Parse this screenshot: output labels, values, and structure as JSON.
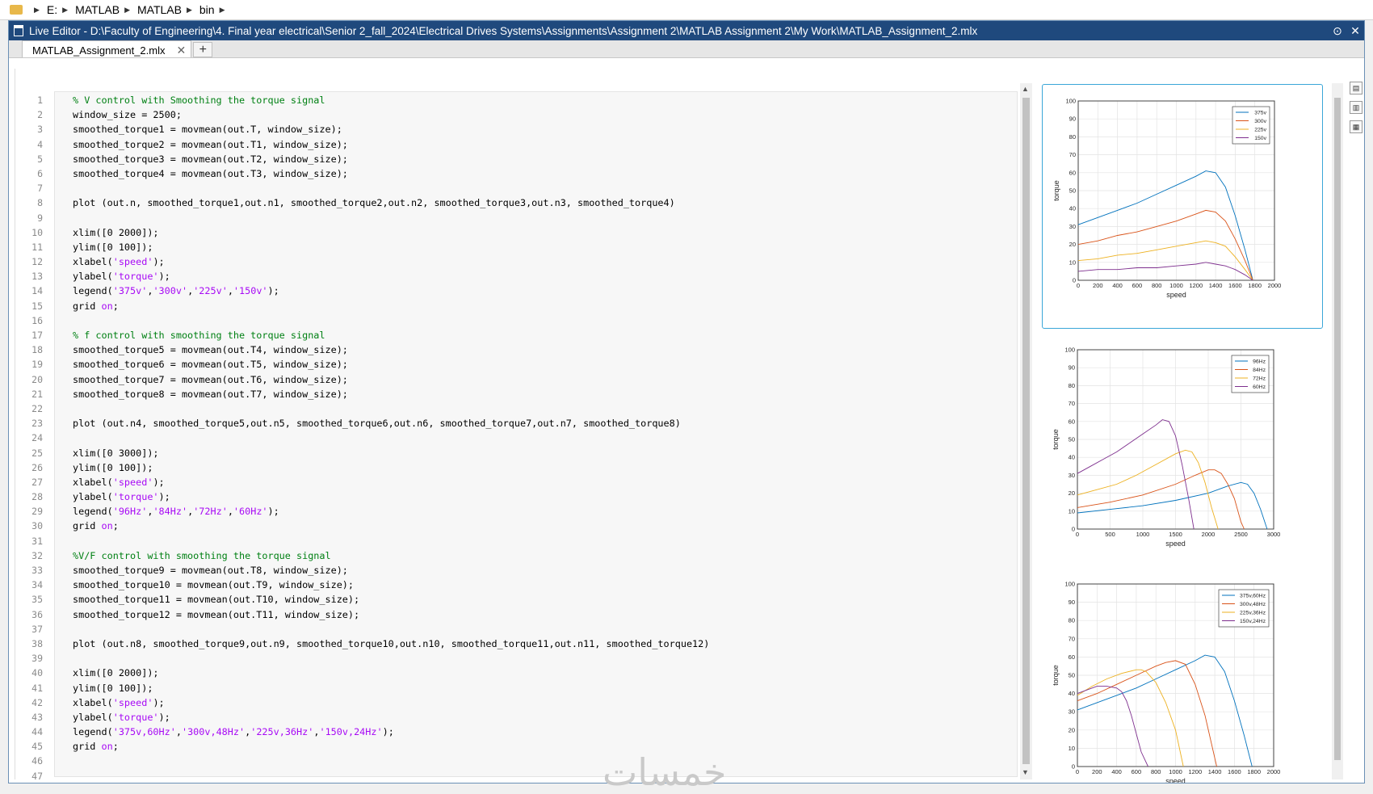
{
  "breadcrumb": [
    "E:",
    "MATLAB",
    "MATLAB",
    "bin"
  ],
  "window": {
    "title": "Live Editor - D:\\Faculty of Engineering\\4. Final year electrical\\Senior 2_fall_2024\\Electrical Drives Systems\\Assignments\\Assignment 2\\MATLAB Assignment 2\\My Work\\MATLAB_Assignment_2.mlx"
  },
  "tab": {
    "label": "MATLAB_Assignment_2.mlx",
    "add": "+"
  },
  "watermark": "خمسات",
  "code": [
    [
      [
        "cm",
        "% V control with Smoothing the torque signal"
      ]
    ],
    [
      [
        "",
        "window_size = 2500;"
      ]
    ],
    [
      [
        "",
        "smoothed_torque1 = movmean(out.T, window_size);"
      ]
    ],
    [
      [
        "",
        "smoothed_torque2 = movmean(out.T1, window_size);"
      ]
    ],
    [
      [
        "",
        "smoothed_torque3 = movmean(out.T2, window_size);"
      ]
    ],
    [
      [
        "",
        "smoothed_torque4 = movmean(out.T3, window_size);"
      ]
    ],
    [],
    [
      [
        "",
        "plot (out.n, smoothed_torque1,out.n1, smoothed_torque2,out.n2, smoothed_torque3,out.n3, smoothed_torque4)"
      ]
    ],
    [],
    [
      [
        "",
        "xlim([0 2000]);"
      ]
    ],
    [
      [
        "",
        "ylim([0 100]);"
      ]
    ],
    [
      [
        "",
        "xlabel("
      ],
      [
        "st",
        "'speed'"
      ],
      [
        "",
        ");"
      ]
    ],
    [
      [
        "",
        "ylabel("
      ],
      [
        "st",
        "'torque'"
      ],
      [
        "",
        ");"
      ]
    ],
    [
      [
        "",
        "legend("
      ],
      [
        "st",
        "'375v'"
      ],
      [
        "",
        ","
      ],
      [
        "st",
        "'300v'"
      ],
      [
        "",
        ","
      ],
      [
        "st",
        "'225v'"
      ],
      [
        "",
        ","
      ],
      [
        "st",
        "'150v'"
      ],
      [
        "",
        ");"
      ]
    ],
    [
      [
        "",
        "grid "
      ],
      [
        "kw",
        "on"
      ],
      [
        "",
        ";"
      ]
    ],
    [],
    [
      [
        "cm",
        "% f control with smoothing the torque signal"
      ]
    ],
    [
      [
        "",
        "smoothed_torque5 = movmean(out.T4, window_size);"
      ]
    ],
    [
      [
        "",
        "smoothed_torque6 = movmean(out.T5, window_size);"
      ]
    ],
    [
      [
        "",
        "smoothed_torque7 = movmean(out.T6, window_size);"
      ]
    ],
    [
      [
        "",
        "smoothed_torque8 = movmean(out.T7, window_size);"
      ]
    ],
    [],
    [
      [
        "",
        "plot (out.n4, smoothed_torque5,out.n5, smoothed_torque6,out.n6, smoothed_torque7,out.n7, smoothed_torque8)"
      ]
    ],
    [],
    [
      [
        "",
        "xlim([0 3000]);"
      ]
    ],
    [
      [
        "",
        "ylim([0 100]);"
      ]
    ],
    [
      [
        "",
        "xlabel("
      ],
      [
        "st",
        "'speed'"
      ],
      [
        "",
        ");"
      ]
    ],
    [
      [
        "",
        "ylabel("
      ],
      [
        "st",
        "'torque'"
      ],
      [
        "",
        ");"
      ]
    ],
    [
      [
        "",
        "legend("
      ],
      [
        "st",
        "'96Hz'"
      ],
      [
        "",
        ","
      ],
      [
        "st",
        "'84Hz'"
      ],
      [
        "",
        ","
      ],
      [
        "st",
        "'72Hz'"
      ],
      [
        "",
        ","
      ],
      [
        "st",
        "'60Hz'"
      ],
      [
        "",
        ");"
      ]
    ],
    [
      [
        "",
        "grid "
      ],
      [
        "kw",
        "on"
      ],
      [
        "",
        ";"
      ]
    ],
    [],
    [
      [
        "cm",
        "%V/F control with smoothing the torque signal"
      ]
    ],
    [
      [
        "",
        "smoothed_torque9 = movmean(out.T8, window_size);"
      ]
    ],
    [
      [
        "",
        "smoothed_torque10 = movmean(out.T9, window_size);"
      ]
    ],
    [
      [
        "",
        "smoothed_torque11 = movmean(out.T10, window_size);"
      ]
    ],
    [
      [
        "",
        "smoothed_torque12 = movmean(out.T11, window_size);"
      ]
    ],
    [],
    [
      [
        "",
        "plot (out.n8, smoothed_torque9,out.n9, smoothed_torque10,out.n10, smoothed_torque11,out.n11, smoothed_torque12)"
      ]
    ],
    [],
    [
      [
        "",
        "xlim([0 2000]);"
      ]
    ],
    [
      [
        "",
        "ylim([0 100]);"
      ]
    ],
    [
      [
        "",
        "xlabel("
      ],
      [
        "st",
        "'speed'"
      ],
      [
        "",
        ");"
      ]
    ],
    [
      [
        "",
        "ylabel("
      ],
      [
        "st",
        "'torque'"
      ],
      [
        "",
        ");"
      ]
    ],
    [
      [
        "",
        "legend("
      ],
      [
        "st",
        "'375v,60Hz'"
      ],
      [
        "",
        ","
      ],
      [
        "st",
        "'300v,48Hz'"
      ],
      [
        "",
        ","
      ],
      [
        "st",
        "'225v,36Hz'"
      ],
      [
        "",
        ","
      ],
      [
        "st",
        "'150v,24Hz'"
      ],
      [
        "",
        ");"
      ]
    ],
    [
      [
        "",
        "grid "
      ],
      [
        "kw",
        "on"
      ],
      [
        "",
        ";"
      ]
    ],
    [],
    []
  ],
  "colors": {
    "c1": "#0072bd",
    "c2": "#d95319",
    "c3": "#edb120",
    "c4": "#7e2f8e",
    "comment": "#008013",
    "string": "#a709f5"
  },
  "chart_data": [
    {
      "type": "line",
      "xlabel": "speed",
      "ylabel": "torque",
      "xlim": [
        0,
        2000
      ],
      "ylim": [
        0,
        100
      ],
      "xticks": [
        0,
        200,
        400,
        600,
        800,
        1000,
        1200,
        1400,
        1600,
        1800,
        2000
      ],
      "yticks": [
        0,
        10,
        20,
        30,
        40,
        50,
        60,
        70,
        80,
        90,
        100
      ],
      "grid": true,
      "legend_position": "top-right",
      "series": [
        {
          "name": "375v",
          "x": [
            0,
            200,
            400,
            600,
            800,
            1000,
            1200,
            1300,
            1400,
            1500,
            1600,
            1700,
            1780
          ],
          "y": [
            31,
            35,
            39,
            43,
            48,
            53,
            58,
            61,
            60,
            52,
            36,
            17,
            0
          ]
        },
        {
          "name": "300v",
          "x": [
            0,
            200,
            400,
            600,
            800,
            1000,
            1200,
            1300,
            1400,
            1500,
            1600,
            1700,
            1780
          ],
          "y": [
            20,
            22,
            25,
            27,
            30,
            33,
            37,
            39,
            38,
            33,
            23,
            11,
            0
          ]
        },
        {
          "name": "225v",
          "x": [
            0,
            200,
            400,
            600,
            800,
            1000,
            1200,
            1300,
            1400,
            1500,
            1600,
            1700,
            1780
          ],
          "y": [
            11,
            12,
            14,
            15,
            17,
            19,
            21,
            22,
            21,
            19,
            13,
            6,
            0
          ]
        },
        {
          "name": "150v",
          "x": [
            0,
            200,
            400,
            600,
            800,
            1000,
            1200,
            1300,
            1400,
            1500,
            1600,
            1700,
            1780
          ],
          "y": [
            5,
            6,
            6,
            7,
            7,
            8,
            9,
            10,
            9,
            8,
            6,
            3,
            0
          ]
        }
      ]
    },
    {
      "type": "line",
      "xlabel": "speed",
      "ylabel": "torque",
      "xlim": [
        0,
        3000
      ],
      "ylim": [
        0,
        100
      ],
      "xticks": [
        0,
        500,
        1000,
        1500,
        2000,
        2500,
        3000
      ],
      "yticks": [
        0,
        10,
        20,
        30,
        40,
        50,
        60,
        70,
        80,
        90,
        100
      ],
      "grid": true,
      "legend_position": "top-right",
      "series": [
        {
          "name": "96Hz",
          "x": [
            0,
            500,
            1000,
            1500,
            2000,
            2300,
            2500,
            2600,
            2700,
            2800,
            2900
          ],
          "y": [
            9,
            11,
            13,
            16,
            20,
            24,
            26,
            25,
            20,
            11,
            0
          ]
        },
        {
          "name": "84Hz",
          "x": [
            0,
            500,
            1000,
            1500,
            1800,
            2000,
            2100,
            2200,
            2300,
            2400,
            2500,
            2550
          ],
          "y": [
            12,
            15,
            19,
            25,
            30,
            33,
            33,
            31,
            25,
            17,
            4,
            0
          ]
        },
        {
          "name": "72Hz",
          "x": [
            0,
            300,
            600,
            900,
            1200,
            1500,
            1650,
            1750,
            1850,
            1950,
            2050,
            2150
          ],
          "y": [
            19,
            22,
            25,
            30,
            36,
            42,
            44,
            43,
            37,
            26,
            12,
            0
          ]
        },
        {
          "name": "60Hz",
          "x": [
            0,
            200,
            400,
            600,
            800,
            1000,
            1200,
            1300,
            1400,
            1500,
            1600,
            1700,
            1780
          ],
          "y": [
            31,
            35,
            39,
            43,
            48,
            53,
            58,
            61,
            60,
            52,
            36,
            17,
            0
          ]
        }
      ]
    },
    {
      "type": "line",
      "xlabel": "speed",
      "ylabel": "torque",
      "xlim": [
        0,
        2000
      ],
      "ylim": [
        0,
        100
      ],
      "xticks": [
        0,
        200,
        400,
        600,
        800,
        1000,
        1200,
        1400,
        1600,
        1800,
        2000
      ],
      "yticks": [
        0,
        10,
        20,
        30,
        40,
        50,
        60,
        70,
        80,
        90,
        100
      ],
      "grid": true,
      "legend_position": "top-right",
      "series": [
        {
          "name": "375v,60Hz",
          "x": [
            0,
            200,
            400,
            600,
            800,
            1000,
            1200,
            1300,
            1400,
            1500,
            1600,
            1700,
            1780
          ],
          "y": [
            31,
            35,
            39,
            43,
            48,
            53,
            58,
            61,
            60,
            52,
            36,
            17,
            0
          ]
        },
        {
          "name": "300v,48Hz",
          "x": [
            0,
            200,
            400,
            600,
            800,
            900,
            1000,
            1100,
            1200,
            1300,
            1420
          ],
          "y": [
            36,
            40,
            45,
            50,
            55,
            57,
            58,
            56,
            45,
            28,
            0
          ]
        },
        {
          "name": "225v,36Hz",
          "x": [
            0,
            150,
            300,
            450,
            600,
            650,
            700,
            800,
            900,
            1000,
            1080
          ],
          "y": [
            39,
            44,
            48,
            51,
            53,
            53,
            52,
            46,
            35,
            20,
            0
          ]
        },
        {
          "name": "150v,24Hz",
          "x": [
            0,
            100,
            200,
            300,
            400,
            450,
            500,
            550,
            600,
            650,
            720
          ],
          "y": [
            40,
            42,
            44,
            44,
            43,
            41,
            36,
            28,
            18,
            8,
            0
          ]
        }
      ]
    }
  ]
}
